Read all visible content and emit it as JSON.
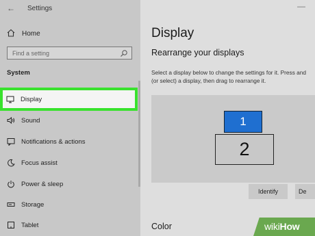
{
  "window": {
    "title": "Settings"
  },
  "sidebar": {
    "home_label": "Home",
    "search_placeholder": "Find a setting",
    "section_label": "System",
    "items": [
      {
        "label": "Display",
        "icon": "monitor-icon",
        "selected": true
      },
      {
        "label": "Sound",
        "icon": "speaker-icon"
      },
      {
        "label": "Notifications & actions",
        "icon": "notifications-icon"
      },
      {
        "label": "Focus assist",
        "icon": "moon-icon"
      },
      {
        "label": "Power & sleep",
        "icon": "power-icon"
      },
      {
        "label": "Storage",
        "icon": "storage-icon"
      },
      {
        "label": "Tablet",
        "icon": "tablet-icon"
      }
    ]
  },
  "main": {
    "title": "Display",
    "subheading": "Rearrange your displays",
    "description_line1": "Select a display below to change the settings for it. Press and",
    "description_line2": "(or select) a display, then drag to rearrange it.",
    "monitors": [
      "1",
      "2"
    ],
    "identify_label": "Identify",
    "detect_label": "De",
    "color_heading": "Color"
  },
  "watermark": {
    "part1": "wiki",
    "part2": "How"
  },
  "colors": {
    "highlight": "#39e22e",
    "monitor_selected": "#1f6fd0",
    "watermark": "#6aa84f"
  }
}
